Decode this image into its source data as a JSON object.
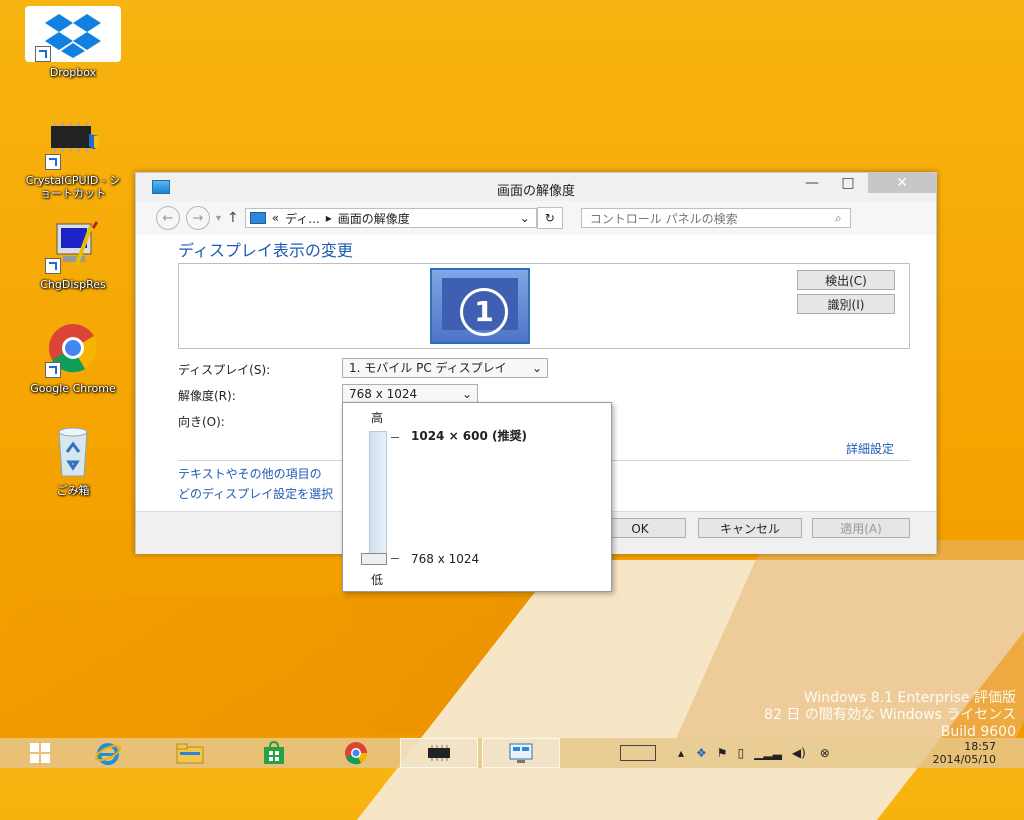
{
  "desktop": {
    "icons": [
      {
        "label": "Dropbox"
      },
      {
        "label": "CrystalCPUID - シ\nョートカット"
      },
      {
        "label": "ChgDispRes"
      },
      {
        "label": "Google Chrome"
      },
      {
        "label": "ごみ箱"
      }
    ],
    "watermark": {
      "line1": "Windows 8.1 Enterprise 評価版",
      "line2": "82 日 の間有効な Windows ライセンス",
      "line3": "Build 9600"
    }
  },
  "window": {
    "title": "画面の解像度",
    "controls": {
      "minimize": "—",
      "maximize": "□",
      "close": "✕"
    },
    "address": {
      "chevron": "«",
      "crumb1": "ディ...",
      "sep": "▸",
      "crumb2": "画面の解像度"
    },
    "search_placeholder": "コントロール パネルの検索",
    "heading": "ディスプレイ表示の変更",
    "monitor_number": "1",
    "detect_button": "検出(C)",
    "identify_button": "識別(I)",
    "display_label": "ディスプレイ(S):",
    "display_value": "1. モバイル PC ディスプレイ",
    "resolution_label": "解像度(R):",
    "resolution_value": "768 x 1024",
    "orientation_label": "向き(O):",
    "advanced_link": "詳細設定",
    "link1": "テキストやその他の項目の",
    "link2": "どのディスプレイ設定を選択",
    "ok": "OK",
    "cancel": "キャンセル",
    "apply": "適用(A)"
  },
  "resolution_popup": {
    "high_label": "高",
    "low_label": "低",
    "top_option": "1024 × 600 (推奨)",
    "bottom_option": "768 x 1024",
    "slider_level": 0
  },
  "taskbar": {
    "time": "18:57",
    "date": "2014/05/10"
  }
}
